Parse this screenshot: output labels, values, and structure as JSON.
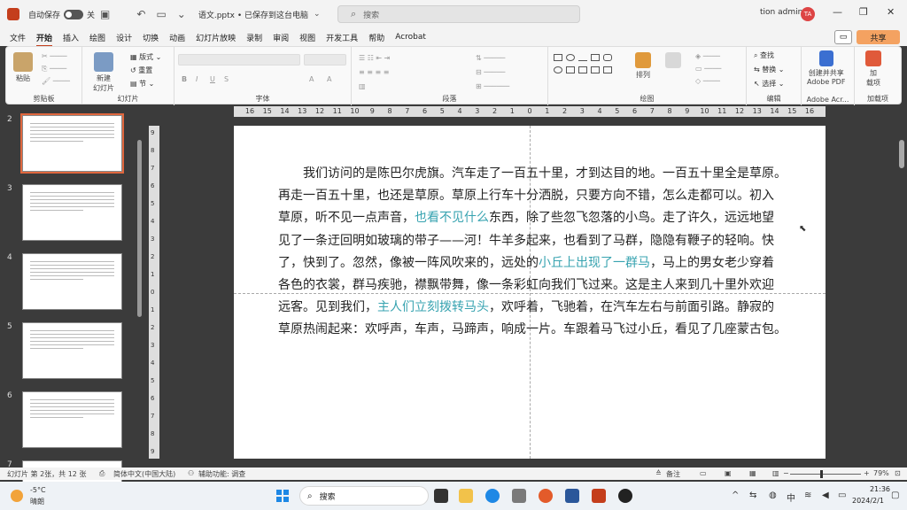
{
  "titlebar": {
    "autosave_label": "自动保存",
    "autosave_state": "关",
    "doc_title": "语文.pptx • 已保存到这台电脑",
    "search_placeholder": "搜索",
    "user_name": "tion admin",
    "user_initials": "TA"
  },
  "menu": {
    "tabs": [
      "文件",
      "开始",
      "插入",
      "绘图",
      "设计",
      "切换",
      "动画",
      "幻灯片放映",
      "录制",
      "审阅",
      "视图",
      "开发工具",
      "帮助",
      "Acrobat"
    ],
    "active_tab": "开始",
    "share_label": "共享"
  },
  "ribbon": {
    "groups": {
      "clipboard": "剪贴板",
      "slides": "幻灯片",
      "font": "字体",
      "paragraph": "段落",
      "drawing": "绘图",
      "editing": "编辑",
      "adobe": "Adobe Acr...",
      "addins": "加载项"
    },
    "paste": "粘贴",
    "new_slide": "新建\n幻灯片",
    "layout": "版式",
    "reset": "重置",
    "section": "节",
    "arrange": "排列",
    "find": "查找",
    "replace": "替换",
    "select": "选择",
    "adobe_create": "创建并共享\nAdobe PDF",
    "addins": "加\n载项"
  },
  "slides_panel": {
    "numbers": [
      "2",
      "3",
      "4",
      "5",
      "6",
      "7"
    ],
    "selected": "2"
  },
  "ruler": {
    "h_ticks": [
      "16",
      "15",
      "14",
      "13",
      "12",
      "11",
      "10",
      "9",
      "8",
      "7",
      "6",
      "5",
      "4",
      "3",
      "2",
      "1",
      "0",
      "1",
      "2",
      "3",
      "4",
      "5",
      "6",
      "7",
      "8",
      "9",
      "10",
      "11",
      "12",
      "13",
      "14",
      "15",
      "16"
    ],
    "v_ticks": [
      "9",
      "8",
      "7",
      "6",
      "5",
      "4",
      "3",
      "2",
      "1",
      "0",
      "1",
      "2",
      "3",
      "4",
      "5",
      "6",
      "7",
      "8",
      "9"
    ]
  },
  "slide": {
    "lines": [
      [
        {
          "t": "　　我们访问的是陈巴尔虎旗。汽车走了一百五十里，才到达目的地。一百五十里全是草原。",
          "h": false
        }
      ],
      [
        {
          "t": "再走一百五十里，也还是草原。草原上行车十分洒脱，只要方向不错，怎么走都可以。初入",
          "h": false
        }
      ],
      [
        {
          "t": "草原，听不见一点声音，",
          "h": false
        },
        {
          "t": "也看不见什么",
          "h": true
        },
        {
          "t": "东西，除了些忽飞忽落的小鸟。走了许久，远远地望",
          "h": false
        }
      ],
      [
        {
          "t": "见了一条迂回明如玻璃的带子——河！牛羊多起来，也看到了马群，隐隐有鞭子的轻响。快",
          "h": false
        }
      ],
      [
        {
          "t": "了，快到了。忽然，像被一阵风吹来的，远处的",
          "h": false
        },
        {
          "t": "小丘上出现了一群马",
          "h": true
        },
        {
          "t": "，马上的男女老少穿着",
          "h": false
        }
      ],
      [
        {
          "t": "各色的衣裳，群马疾驰，襟飘带舞，像一条彩虹向我们飞过来。这是主人来到几十里外欢迎",
          "h": false
        }
      ],
      [
        {
          "t": "远客。见到我们，",
          "h": false
        },
        {
          "t": "主人们立刻拨转马头",
          "h": true
        },
        {
          "t": "，欢呼着，飞驰着，在汽车左右与前面引路。静寂的",
          "h": false
        }
      ],
      [
        {
          "t": "草原热闹起来：欢呼声，车声，马蹄声，响成一片。车跟着马飞过小丘，看见了几座蒙古包。",
          "h": false
        }
      ]
    ],
    "highlight_color": "#37a3b0"
  },
  "statusbar": {
    "slide_info": "幻灯片 第 2张，共 12 张",
    "language": "简体中文(中国大陆)",
    "accessibility": "辅助功能: 调查",
    "notes": "备注",
    "zoom": "79%"
  },
  "taskbar": {
    "weather_temp": "-5°C",
    "weather_desc": "晴朗",
    "search_placeholder": "搜索",
    "ime": "中",
    "time": "21:36",
    "date": "2024/2/1"
  }
}
